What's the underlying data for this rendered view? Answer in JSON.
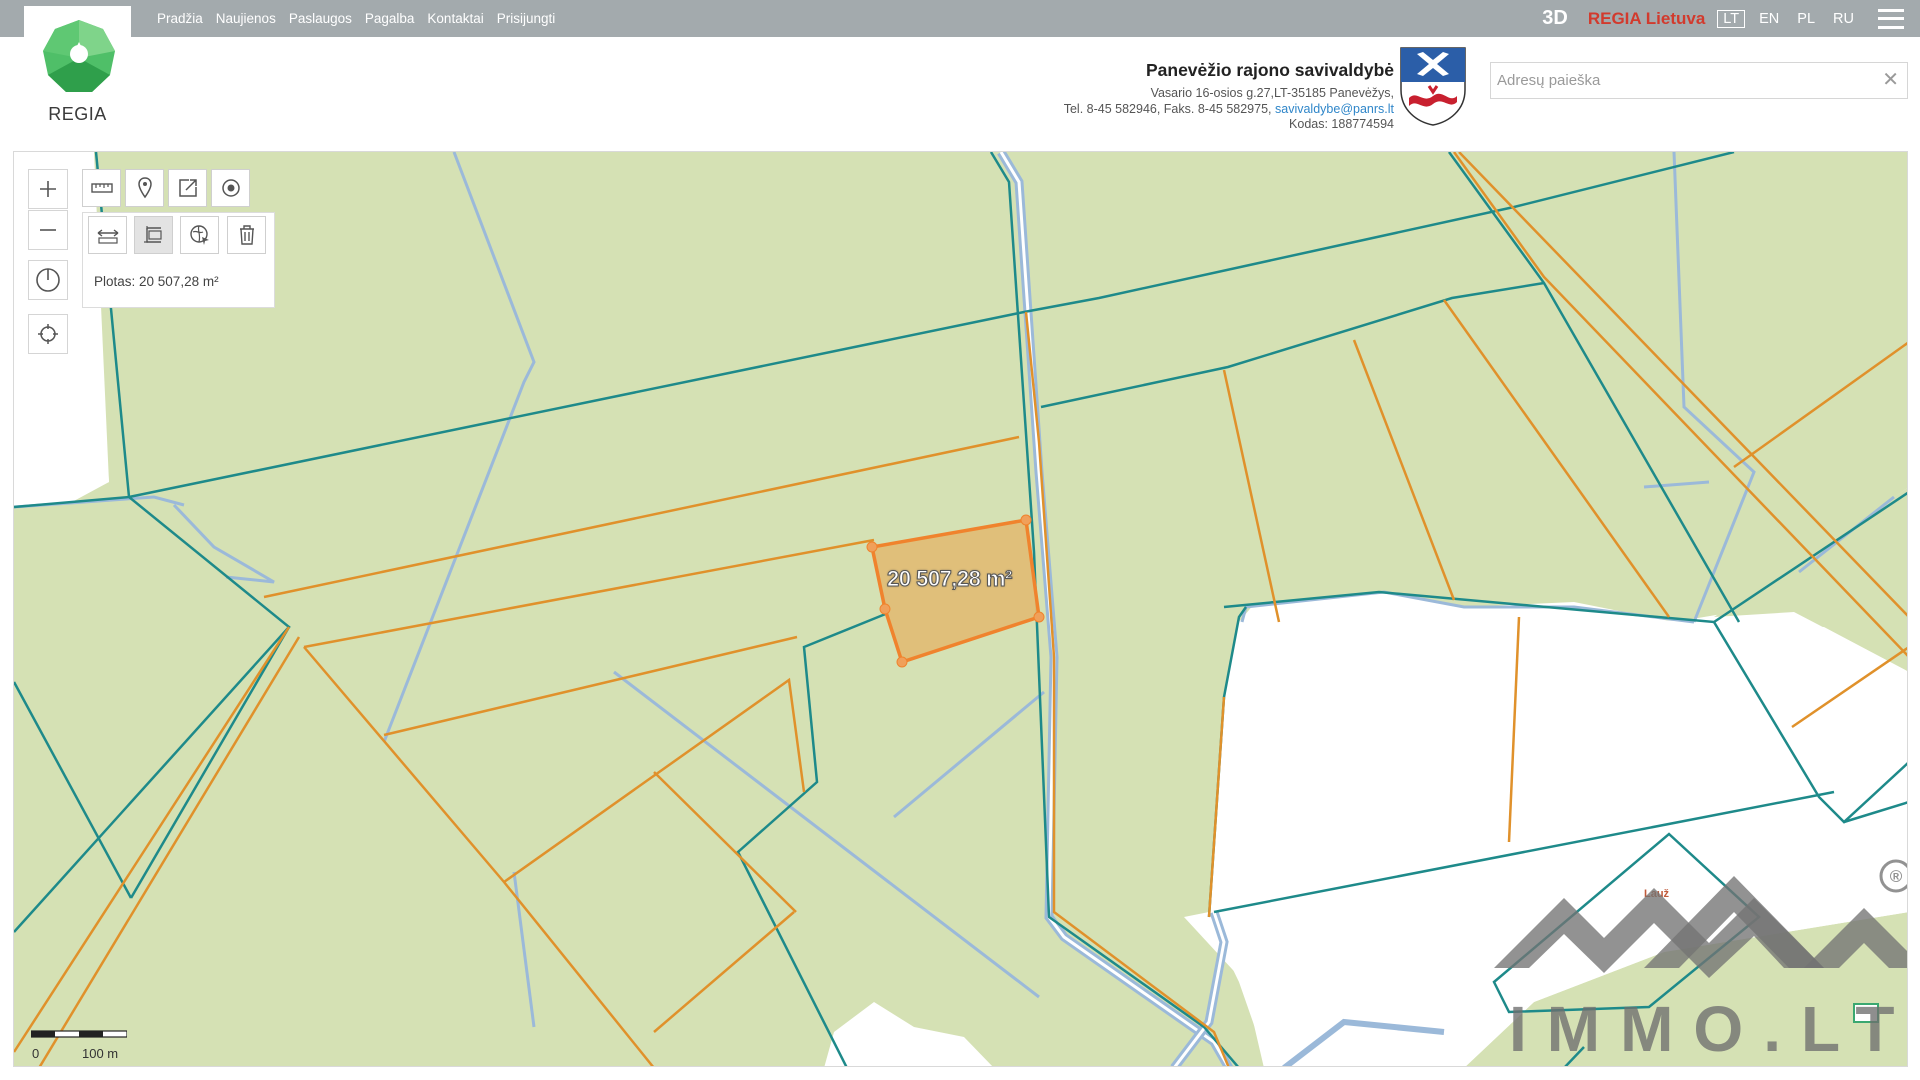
{
  "nav": {
    "items": [
      "Pradžia",
      "Naujienos",
      "Paslaugos",
      "Pagalba",
      "Kontaktai",
      "Prisijungti"
    ],
    "btn_3d": "3D",
    "regia_lietuva": "REGIA Lietuva",
    "languages": [
      "LT",
      "EN",
      "PL",
      "RU"
    ],
    "active_language": "LT"
  },
  "header": {
    "logo_text": "REGIA",
    "municipality": {
      "name": "Panevėžio rajono savivaldybė",
      "address": "Vasario 16-osios g.27,LT-35185 Panevėžys,",
      "phone": "Tel. 8-45 582946, Faks. 8-45 582975,",
      "email": "savivaldybe@panrs.lt",
      "code": "Kodas: 188774594"
    },
    "search": {
      "placeholder": "Adresų paieška",
      "value": "",
      "clear_icon": "close-icon"
    }
  },
  "tools": {
    "row1": [
      "ruler-icon",
      "marker-icon",
      "export-icon",
      "target-icon"
    ],
    "row2": [
      "measure-distance-icon",
      "measure-area-icon",
      "map-cursor-icon",
      "trash-icon"
    ],
    "active": "measure-area-icon",
    "area_result": "Plotas: 20 507,28 m²"
  },
  "map": {
    "area_label": "20 507,28 m²",
    "place_label": "Lauž",
    "scale": {
      "zero": "0",
      "distance": "100 m"
    },
    "colors": {
      "forest": "#d5e1b4",
      "parcel_teal": "#1e8a8a",
      "parcel_orange": "#e0912b",
      "water_blue": "#9bb9d9",
      "measure_fill": "#e0bd77",
      "measure_stroke": "#f0832d"
    }
  },
  "watermark": {
    "text": "IMMO.LT",
    "registered": "®"
  }
}
